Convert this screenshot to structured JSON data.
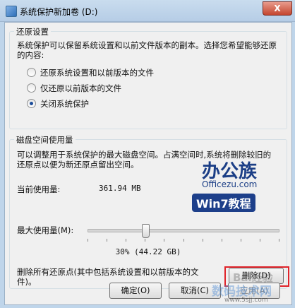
{
  "window": {
    "title": "系统保护新加卷 (D:)",
    "close_glyph": "X"
  },
  "restore": {
    "group_label": "还原设置",
    "description": "系统保护可以保留系统设置和以前文件版本的副本。选择您希望能够还原的内容:",
    "options": [
      {
        "label": "还原系统设置和以前版本的文件",
        "checked": false
      },
      {
        "label": "仅还原以前版本的文件",
        "checked": false
      },
      {
        "label": "关闭系统保护",
        "checked": true
      }
    ]
  },
  "disk": {
    "group_label": "磁盘空间使用量",
    "description": "可以调整用于系统保护的最大磁盘空间。占满空间时,系统将删除较旧的还原点以便为新还原点留出空间。",
    "current_label": "当前使用量:",
    "current_value": "361.94 MB",
    "max_label": "最大使用量(M):",
    "slider_percent": 30,
    "slider_readout": "30% (44.22 GB)",
    "delete_text": "删除所有还原点(其中包括系统设置和以前版本的文件)。",
    "delete_button": "删除(D)"
  },
  "footer": {
    "ok_button": "确定(O)",
    "cancel_button": "取消(C)",
    "apply_button": "应用(A)"
  },
  "watermarks": {
    "brand": "办公族",
    "site": "Officezu.com",
    "tag": "Win7教程",
    "baidu": "Bai经验",
    "site2": "数码技术网",
    "url": "www.5sjj.com"
  }
}
